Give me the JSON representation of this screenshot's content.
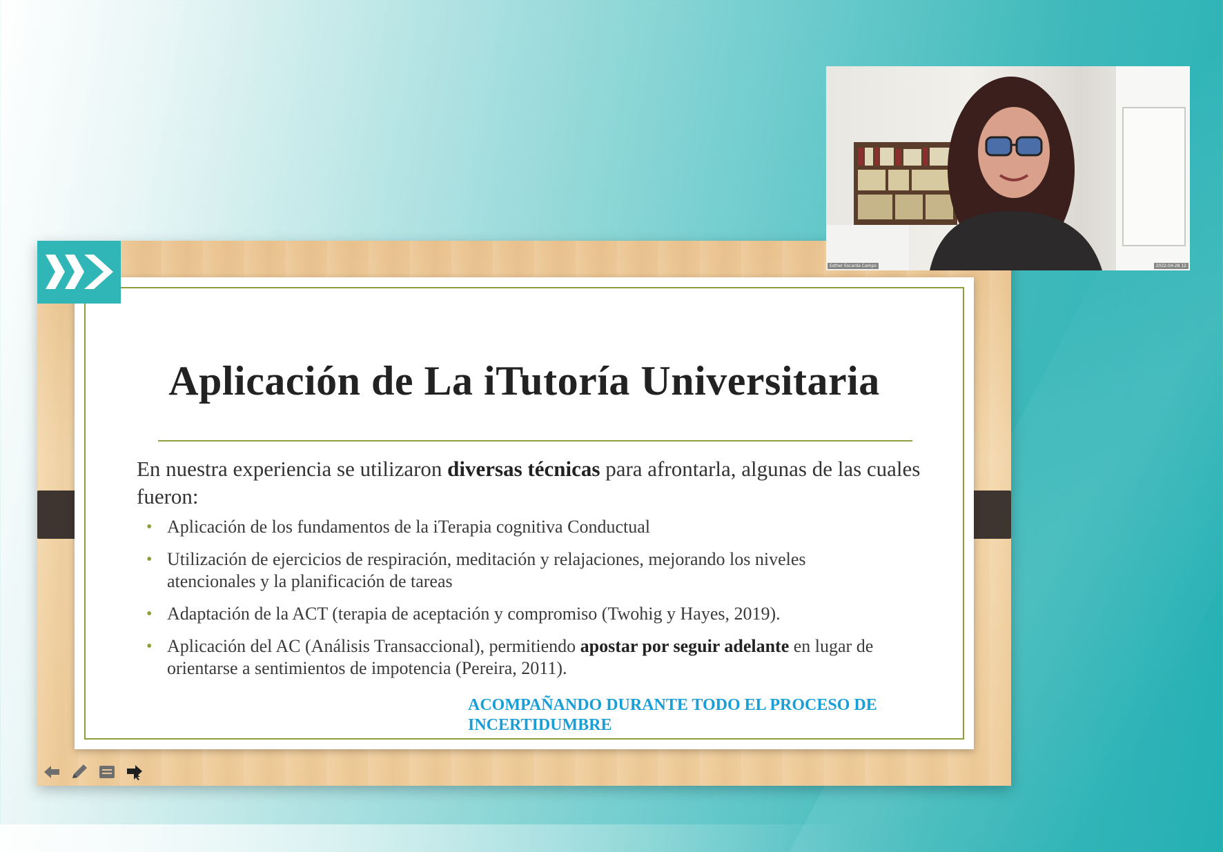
{
  "slide": {
    "title": "Aplicación de La iTutoría Universitaria",
    "intro_before": "En nuestra experiencia se utilizaron ",
    "intro_bold": "diversas técnicas",
    "intro_after": " para afrontarla, algunas de las cuales fueron:",
    "bullets": [
      {
        "text": "Aplicación de los fundamentos de la iTerapia cognitiva Conductual"
      },
      {
        "text": "Utilización de ejercicios de respiración, meditación y relajaciones, mejorando los niveles atencionales y la planificación de tareas"
      },
      {
        "text": "Adaptación de la ACT (terapia de aceptación y compromiso (Twohig y Hayes, 2019)."
      },
      {
        "before": "Aplicación del AC (Análisis Transaccional), permitiendo ",
        "bold": "apostar por seguir adelante",
        "after": " en lugar de orientarse a sentimientos de impotencia (Pereira, 2011)."
      }
    ],
    "highlight": "ACOMPAÑANDO DURANTE TODO EL PROCESO DE INCERTIDUMBRE",
    "bullet_symbol": "•"
  },
  "toolbar": {
    "icons": [
      "arrow-left-icon",
      "pen-icon",
      "notes-icon",
      "arrow-right-icon"
    ]
  },
  "webcam": {
    "name_label": "Esther Escarda Campo",
    "timestamp": "2022-04-28 12"
  },
  "colors": {
    "accent_teal": "#31b6b8",
    "rule_olive": "#8e9d3c",
    "highlight_blue": "#1a9ed6"
  }
}
